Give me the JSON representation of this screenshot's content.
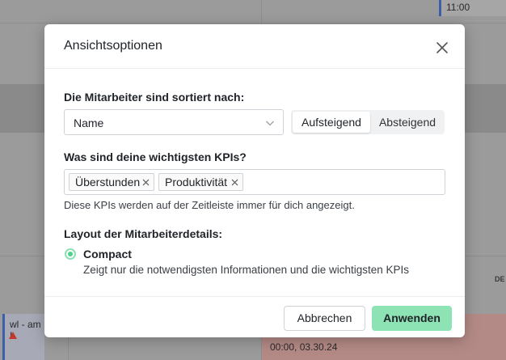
{
  "background": {
    "time_card": "11:00",
    "shift_card": "wl - am I",
    "day_label": "DE",
    "red_card_text": "00:00, 03.30.24"
  },
  "modal": {
    "title": "Ansichtsoptionen",
    "sort_section": {
      "label": "Die Mitarbeiter sind sortiert nach:",
      "selected": "Name",
      "order_options": [
        "Aufsteigend",
        "Absteigend"
      ],
      "active_order": "Aufsteigend"
    },
    "kpi_section": {
      "label": "Was sind deine wichtigsten KPIs?",
      "tags": [
        "Überstunden",
        "Produktivität"
      ],
      "help": "Diese KPIs werden auf der Zeitleiste immer für dich angezeigt."
    },
    "layout_section": {
      "label": "Layout der Mitarbeiterdetails:",
      "option_title": "Compact",
      "option_desc": "Zeigt nur die notwendigsten Informationen und die wichtigsten KPIs"
    },
    "footer": {
      "cancel": "Abbrechen",
      "apply": "Anwenden"
    }
  },
  "colors": {
    "accent": "#8ee3b4",
    "radio": "#4cd28a",
    "overlay": "#9b9b9b"
  }
}
